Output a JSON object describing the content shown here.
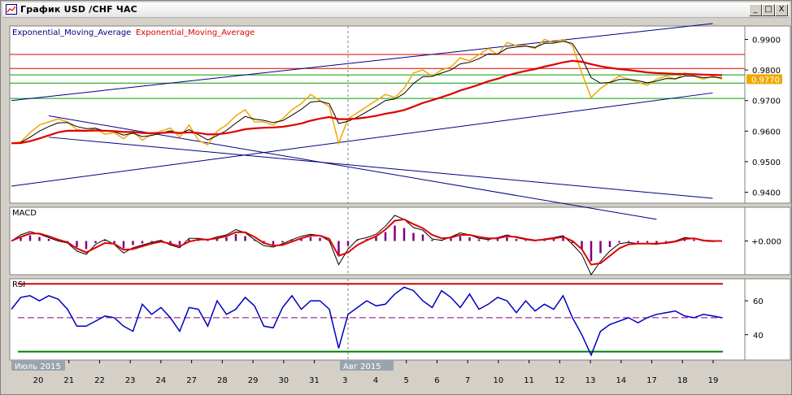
{
  "window": {
    "title": "График USD /CHF ЧАС",
    "buttons": {
      "minimize": "_",
      "maximize": "□",
      "close": "X"
    }
  },
  "colors": {
    "background": "#d4d0c8",
    "price": "#f0a800",
    "ema_fast": "#000000",
    "ema_slow": "#e00000",
    "channel": "#000080",
    "support": "#00a000",
    "resistance": "#e00000",
    "macd_hist": "#800080",
    "rsi": "#0000c0"
  },
  "chart_data": [
    {
      "type": "line",
      "panel": "price",
      "legend": [
        "Exponential_Moving_Average",
        "Exponential_Moving_Average"
      ],
      "y_ticks": [
        "0.9900",
        "0.9800",
        "0.9700",
        "0.9600",
        "0.9500",
        "0.9400"
      ],
      "ylim": [
        0.9364,
        0.9944
      ],
      "current_price_label": "0.9770",
      "series": [
        {
          "role": "price",
          "values": [
            0.956,
            0.9565,
            0.9595,
            0.962,
            0.963,
            0.964,
            0.963,
            0.9605,
            0.96,
            0.961,
            0.959,
            0.9595,
            0.9575,
            0.96,
            0.957,
            0.959,
            0.96,
            0.961,
            0.958,
            0.962,
            0.957,
            0.9555,
            0.96,
            0.962,
            0.965,
            0.967,
            0.963,
            0.963,
            0.962,
            0.964,
            0.967,
            0.969,
            0.972,
            0.97,
            0.968,
            0.956,
            0.964,
            0.966,
            0.968,
            0.97,
            0.972,
            0.971,
            0.974,
            0.979,
            0.98,
            0.978,
            0.98,
            0.981,
            0.984,
            0.983,
            0.985,
            0.987,
            0.985,
            0.989,
            0.988,
            0.988,
            0.987,
            0.99,
            0.989,
            0.99,
            0.988,
            0.979,
            0.971,
            0.974,
            0.976,
            0.978,
            0.977,
            0.976,
            0.975,
            0.977,
            0.978,
            0.977,
            0.979,
            0.978,
            0.977,
            0.978,
            0.977
          ]
        },
        {
          "role": "ema_fast",
          "values": [
            0.956,
            0.9563,
            0.958,
            0.96,
            0.9615,
            0.9627,
            0.9628,
            0.9615,
            0.9608,
            0.9609,
            0.96,
            0.9598,
            0.9587,
            0.9593,
            0.9582,
            0.9586,
            0.9593,
            0.9601,
            0.9591,
            0.9605,
            0.9588,
            0.9571,
            0.9585,
            0.9602,
            0.9626,
            0.9648,
            0.9639,
            0.9635,
            0.9628,
            0.9634,
            0.9652,
            0.9671,
            0.9695,
            0.9698,
            0.9689,
            0.9625,
            0.9632,
            0.9646,
            0.9663,
            0.9681,
            0.97,
            0.9705,
            0.9723,
            0.9756,
            0.9778,
            0.9779,
            0.979,
            0.98,
            0.982,
            0.9825,
            0.9837,
            0.9853,
            0.9852,
            0.9871,
            0.9875,
            0.9878,
            0.9874,
            0.9887,
            0.9888,
            0.9894,
            0.9887,
            0.9839,
            0.9775,
            0.9757,
            0.9759,
            0.9769,
            0.9769,
            0.9765,
            0.9758,
            0.9764,
            0.9772,
            0.9771,
            0.978,
            0.978,
            0.9775,
            0.9777,
            0.9774
          ]
        },
        {
          "role": "ema_slow",
          "values": [
            0.956,
            0.9561,
            0.9567,
            0.9576,
            0.9586,
            0.9596,
            0.9601,
            0.9601,
            0.9601,
            0.9602,
            0.9601,
            0.96,
            0.9597,
            0.9597,
            0.9594,
            0.9593,
            0.9594,
            0.9596,
            0.9594,
            0.9596,
            0.9594,
            0.9589,
            0.959,
            0.9593,
            0.9599,
            0.9606,
            0.9609,
            0.9611,
            0.9612,
            0.9614,
            0.9619,
            0.9625,
            0.9634,
            0.9641,
            0.9646,
            0.9639,
            0.9639,
            0.9641,
            0.9645,
            0.965,
            0.9657,
            0.9662,
            0.9669,
            0.968,
            0.9692,
            0.9701,
            0.9711,
            0.9721,
            0.9733,
            0.9742,
            0.9752,
            0.9763,
            0.9771,
            0.9782,
            0.979,
            0.9797,
            0.9803,
            0.9811,
            0.9818,
            0.9825,
            0.983,
            0.9827,
            0.9819,
            0.9812,
            0.9807,
            0.9803,
            0.98,
            0.9796,
            0.9792,
            0.979,
            0.9789,
            0.9787,
            0.9787,
            0.9786,
            0.9785,
            0.9784,
            0.9783
          ]
        }
      ],
      "horizontal_lines": [
        {
          "role": "resistance",
          "y": 0.9851
        },
        {
          "role": "resistance",
          "y": 0.9805
        },
        {
          "role": "support",
          "y": 0.9784
        },
        {
          "role": "support",
          "y": 0.9757
        },
        {
          "role": "support",
          "y": 0.9707
        }
      ],
      "trend_lines": [
        {
          "x": [
            0,
            75
          ],
          "y": [
            0.97,
            0.9952
          ]
        },
        {
          "x": [
            0,
            75
          ],
          "y": [
            0.942,
            0.9725
          ]
        },
        {
          "x": [
            4,
            75
          ],
          "y": [
            0.958,
            0.938
          ]
        },
        {
          "x": [
            4,
            69
          ],
          "y": [
            0.965,
            0.9311
          ]
        }
      ]
    },
    {
      "type": "line",
      "panel": "macd",
      "title": "MACD",
      "y_ticks": [
        "+0.000"
      ],
      "ylim": [
        -0.005,
        0.005
      ],
      "series": [
        {
          "role": "macd",
          "values": [
            0.0,
            0.0009,
            0.0014,
            0.001,
            0.0005,
            0.0,
            -0.0003,
            -0.0015,
            -0.002,
            -0.0005,
            0.0002,
            -0.0005,
            -0.0018,
            -0.001,
            -0.0006,
            -0.0002,
            0.0001,
            -0.0006,
            -0.001,
            0.0004,
            0.0004,
            0.0002,
            0.0006,
            0.0009,
            0.0017,
            0.0012,
            0.0002,
            -0.0007,
            -0.0009,
            -0.0004,
            0.0002,
            0.0007,
            0.001,
            0.0008,
            0.0,
            -0.0035,
            -0.0012,
            0.0002,
            0.0005,
            0.001,
            0.0022,
            0.0038,
            0.0032,
            0.002,
            0.0016,
            0.0003,
            0.0001,
            0.0006,
            0.0012,
            0.0009,
            0.0004,
            0.0002,
            0.0005,
            0.0009,
            0.0005,
            0.0002,
            0.0,
            0.0003,
            0.0005,
            0.0008,
            -0.0005,
            -0.002,
            -0.005,
            -0.003,
            -0.0015,
            -0.0004,
            -0.0002,
            -0.0004,
            -0.0004,
            -0.0005,
            -0.0002,
            0.0,
            0.0005,
            0.0004,
            0.0,
            -0.0001,
            0.0
          ]
        },
        {
          "role": "signal",
          "values": [
            0.0,
            0.0006,
            0.0011,
            0.0011,
            0.0007,
            0.0002,
            -0.0002,
            -0.0011,
            -0.0017,
            -0.001,
            -0.0003,
            -0.0004,
            -0.0013,
            -0.0012,
            -0.0008,
            -0.0004,
            -0.0001,
            -0.0004,
            -0.0008,
            -0.0001,
            0.0002,
            0.0002,
            0.0004,
            0.0007,
            0.0013,
            0.0013,
            0.0006,
            -0.0003,
            -0.0007,
            -0.0006,
            -0.0001,
            0.0004,
            0.0008,
            0.0008,
            0.0003,
            -0.0022,
            -0.0017,
            -0.0006,
            0.0001,
            0.0007,
            0.0017,
            0.003,
            0.0032,
            0.0025,
            0.0019,
            0.0009,
            0.0004,
            0.0005,
            0.0009,
            0.0009,
            0.0006,
            0.0004,
            0.0004,
            0.0007,
            0.0006,
            0.0003,
            0.0001,
            0.0002,
            0.0004,
            0.0006,
            0.0,
            -0.0012,
            -0.0035,
            -0.0033,
            -0.0022,
            -0.0011,
            -0.0005,
            -0.0004,
            -0.0004,
            -0.0004,
            -0.0003,
            -0.0001,
            0.0003,
            0.0004,
            0.0001,
            0.0,
            0.0
          ]
        }
      ]
    },
    {
      "type": "line",
      "panel": "rsi",
      "title": "RSI",
      "y_ticks": [
        "60",
        "40"
      ],
      "ylim": [
        25,
        73
      ],
      "series": [
        {
          "role": "rsi",
          "values": [
            55,
            62,
            63,
            60,
            63,
            61,
            55,
            45,
            45,
            48,
            51,
            50,
            45,
            42,
            58,
            52,
            56,
            50,
            42,
            56,
            55,
            45,
            60,
            52,
            55,
            62,
            57,
            45,
            44,
            56,
            63,
            55,
            60,
            60,
            55,
            32,
            52,
            56,
            60,
            57,
            58,
            64,
            68,
            66,
            60,
            56,
            66,
            62,
            56,
            64,
            55,
            58,
            62,
            60,
            53,
            60,
            54,
            58,
            55,
            63,
            50,
            40,
            28,
            42,
            46,
            48,
            50,
            47,
            50,
            52,
            53,
            54,
            51,
            50,
            52,
            51,
            50
          ]
        }
      ],
      "horizontal_lines": [
        {
          "role": "upper",
          "y": 70,
          "color": "#e00000"
        },
        {
          "role": "mid",
          "y": 50,
          "color": "#800080",
          "dashed": true
        },
        {
          "role": "lower",
          "y": 30,
          "color": "#008000"
        }
      ]
    }
  ],
  "x_axis": {
    "day_labels": [
      "20",
      "21",
      "22",
      "23",
      "24",
      "27",
      "28",
      "29",
      "30",
      "31",
      "3",
      "4",
      "5",
      "6",
      "7",
      "10",
      "11",
      "12",
      "13",
      "14",
      "17",
      "18",
      "19"
    ],
    "month_labels": [
      "Июль 2015",
      "Авг 2015"
    ]
  }
}
